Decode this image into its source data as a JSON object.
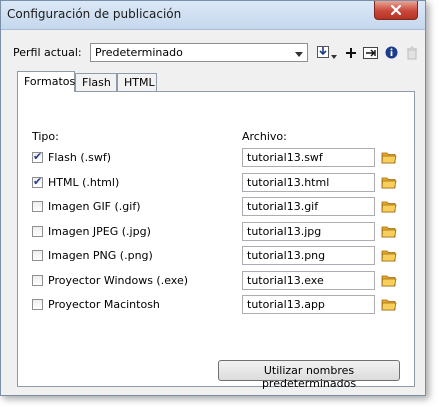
{
  "window": {
    "title": "Configuración de publicación"
  },
  "profile": {
    "label": "Perfil actual:",
    "selected": "Predeterminado"
  },
  "tabs": [
    "Formatos",
    "Flash",
    "HTML"
  ],
  "formats": {
    "type_header": "Tipo:",
    "file_header": "Archivo:",
    "rows": [
      {
        "label": "Flash  (.swf)",
        "checked": true,
        "file": "tutorial13.swf"
      },
      {
        "label": "HTML  (.html)",
        "checked": true,
        "file": "tutorial13.html"
      },
      {
        "label": "Imagen GIF  (.gif)",
        "checked": false,
        "file": "tutorial13.gif"
      },
      {
        "label": "Imagen JPEG  (.jpg)",
        "checked": false,
        "file": "tutorial13.jpg"
      },
      {
        "label": "Imagen PNG  (.png)",
        "checked": false,
        "file": "tutorial13.png"
      },
      {
        "label": "Proyector Windows (.exe)",
        "checked": false,
        "file": "tutorial13.exe"
      },
      {
        "label": "Proyector Macintosh",
        "checked": false,
        "file": "tutorial13.app"
      }
    ],
    "use_defaults_label": "Utilizar nombres predeterminados"
  },
  "icons": {
    "close": "close-icon",
    "dropdown": "chevron-down-icon",
    "import_export": "import-export-icon",
    "add": "plus-icon",
    "duplicate": "duplicate-icon",
    "info": "info-icon",
    "delete": "trash-icon",
    "folder": "folder-icon"
  },
  "colors": {
    "close_button": "#c9483a",
    "folder": "#f2c14e",
    "titlebar": "#c6d8ee"
  }
}
